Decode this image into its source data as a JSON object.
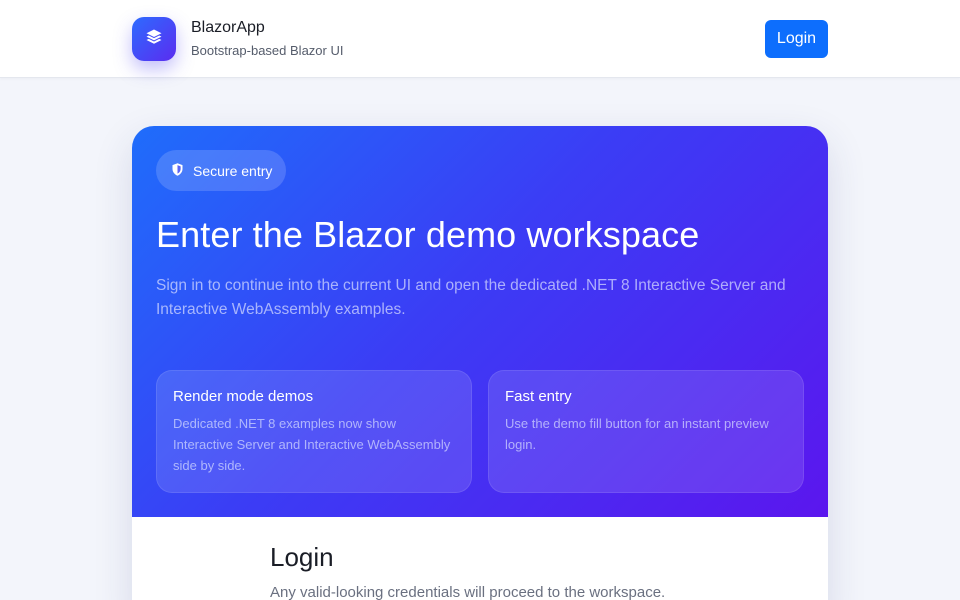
{
  "header": {
    "brand_icon": "layers-icon",
    "brand_name": "BlazorApp",
    "brand_subtitle": "Bootstrap-based Blazor UI",
    "login_label": "Login"
  },
  "hero": {
    "badge_icon": "shield-icon",
    "badge_label": "Secure entry",
    "title": "Enter the Blazor demo workspace",
    "description": "Sign in to continue into the current UI and open the dedicated .NET 8 Interactive Server and Interactive WebAssembly examples.",
    "features": [
      {
        "title": "Render mode demos",
        "text": "Dedicated .NET 8 examples now show Interactive Server and Interactive WebAssembly side by side."
      },
      {
        "title": "Fast entry",
        "text": "Use the demo fill button for an instant preview login."
      }
    ]
  },
  "login": {
    "title": "Login",
    "subtitle": "Any valid-looking credentials will proceed to the workspace."
  },
  "colors": {
    "accent": "#0d6efd",
    "hero_gradient_start": "#1f6dfb",
    "hero_gradient_end": "#5b16ee",
    "page_background": "#f3f5fb"
  }
}
